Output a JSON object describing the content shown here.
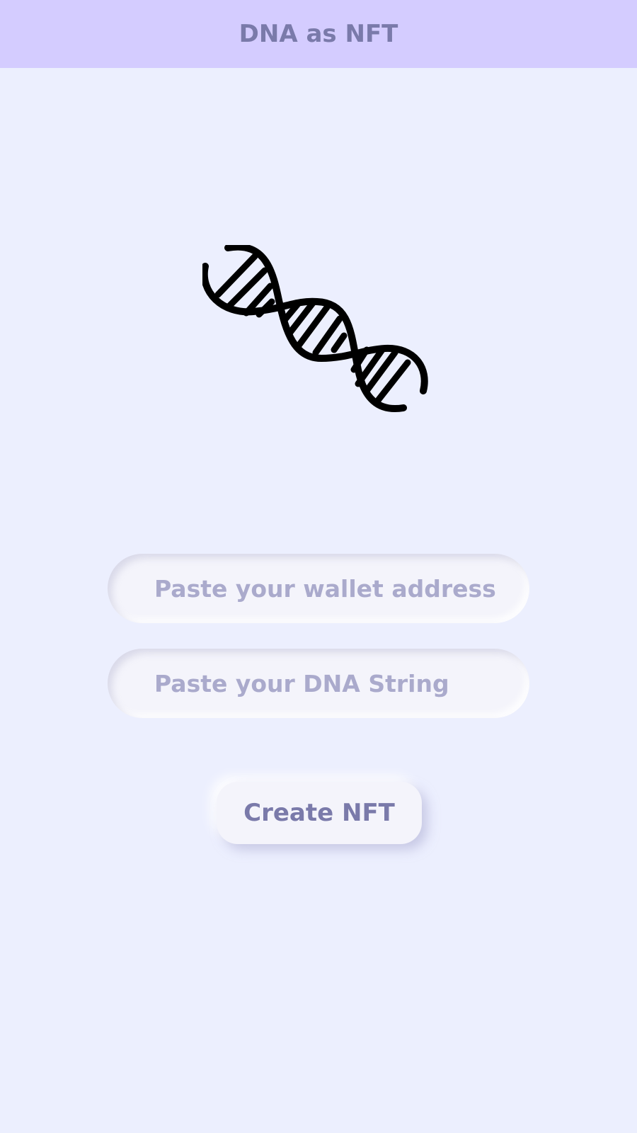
{
  "header": {
    "title": "DNA as NFT"
  },
  "hero": {
    "icon": "dna-icon"
  },
  "form": {
    "wallet_placeholder": "Paste your wallet address",
    "wallet_value": "",
    "dna_placeholder": "Paste your DNA String",
    "dna_value": ""
  },
  "actions": {
    "create_label": "Create NFT"
  },
  "colors": {
    "header_bg": "#d4ccff",
    "page_bg": "#eceffe",
    "title_text": "#7a7aaa",
    "placeholder_text": "#aaaacc"
  }
}
